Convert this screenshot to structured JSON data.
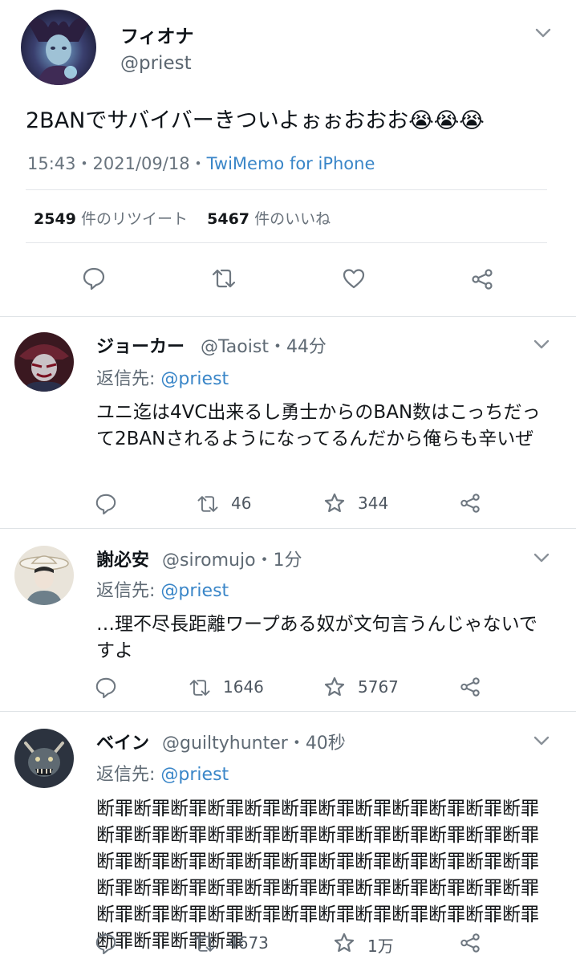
{
  "main_tweet": {
    "name": "フィオナ",
    "handle": "@priest",
    "text": "2BANでサバイバーきついよぉぉおおお😭😭😭",
    "time": "15:43・2021/09/18・",
    "source": "TwiMemo for iPhone",
    "retweet_count": "2549",
    "retweet_label": "件のリツイート",
    "like_count": "5467",
    "like_label": "件のいいね",
    "icons": [
      "reply-icon",
      "retweet-icon",
      "like-icon",
      "share-icon"
    ]
  },
  "replies": [
    {
      "name": "ジョーカー",
      "handle": "@Taoist・44分",
      "reply_to_label": "返信先: ",
      "reply_to": "@priest",
      "text": "ユニ迄は4VC出来るし勇士からのBAN数はこっちだって2BANされるようになってるんだから俺らも辛いぜ",
      "retweets": "46",
      "likes": "344",
      "avatar_color": "#5a2630"
    },
    {
      "name": "謝必安",
      "handle": "@siromujo・1分",
      "reply_to_label": "返信先: ",
      "reply_to": "@priest",
      "text": "…理不尽長距離ワープある奴が文句言うんじゃないですよ",
      "retweets": "1646",
      "likes": "5767",
      "avatar_color": "#e6e0d4"
    },
    {
      "name": "ベイン",
      "handle": "@guiltyhunter・40秒",
      "reply_to_label": "返信先: ",
      "reply_to": "@priest",
      "text": "断罪断罪断罪断罪断罪断罪断罪断罪断罪断罪断罪断罪断罪断罪断罪断罪断罪断罪断罪断罪断罪断罪断罪断罪断罪断罪断罪断罪断罪断罪断罪断罪断罪断罪断罪断罪断罪断罪断罪断罪断罪断罪断罪断罪断罪断罪断罪断罪断罪断罪断罪断罪断罪断罪断罪断罪断罪断罪断罪断罪断罪断罪断罪断罪",
      "retweets": "4673",
      "likes": "1万",
      "avatar_color": "#3a4250"
    }
  ],
  "colors": {
    "link": "#3a86c8",
    "muted": "#69747e",
    "divider": "#e3e6e9"
  }
}
